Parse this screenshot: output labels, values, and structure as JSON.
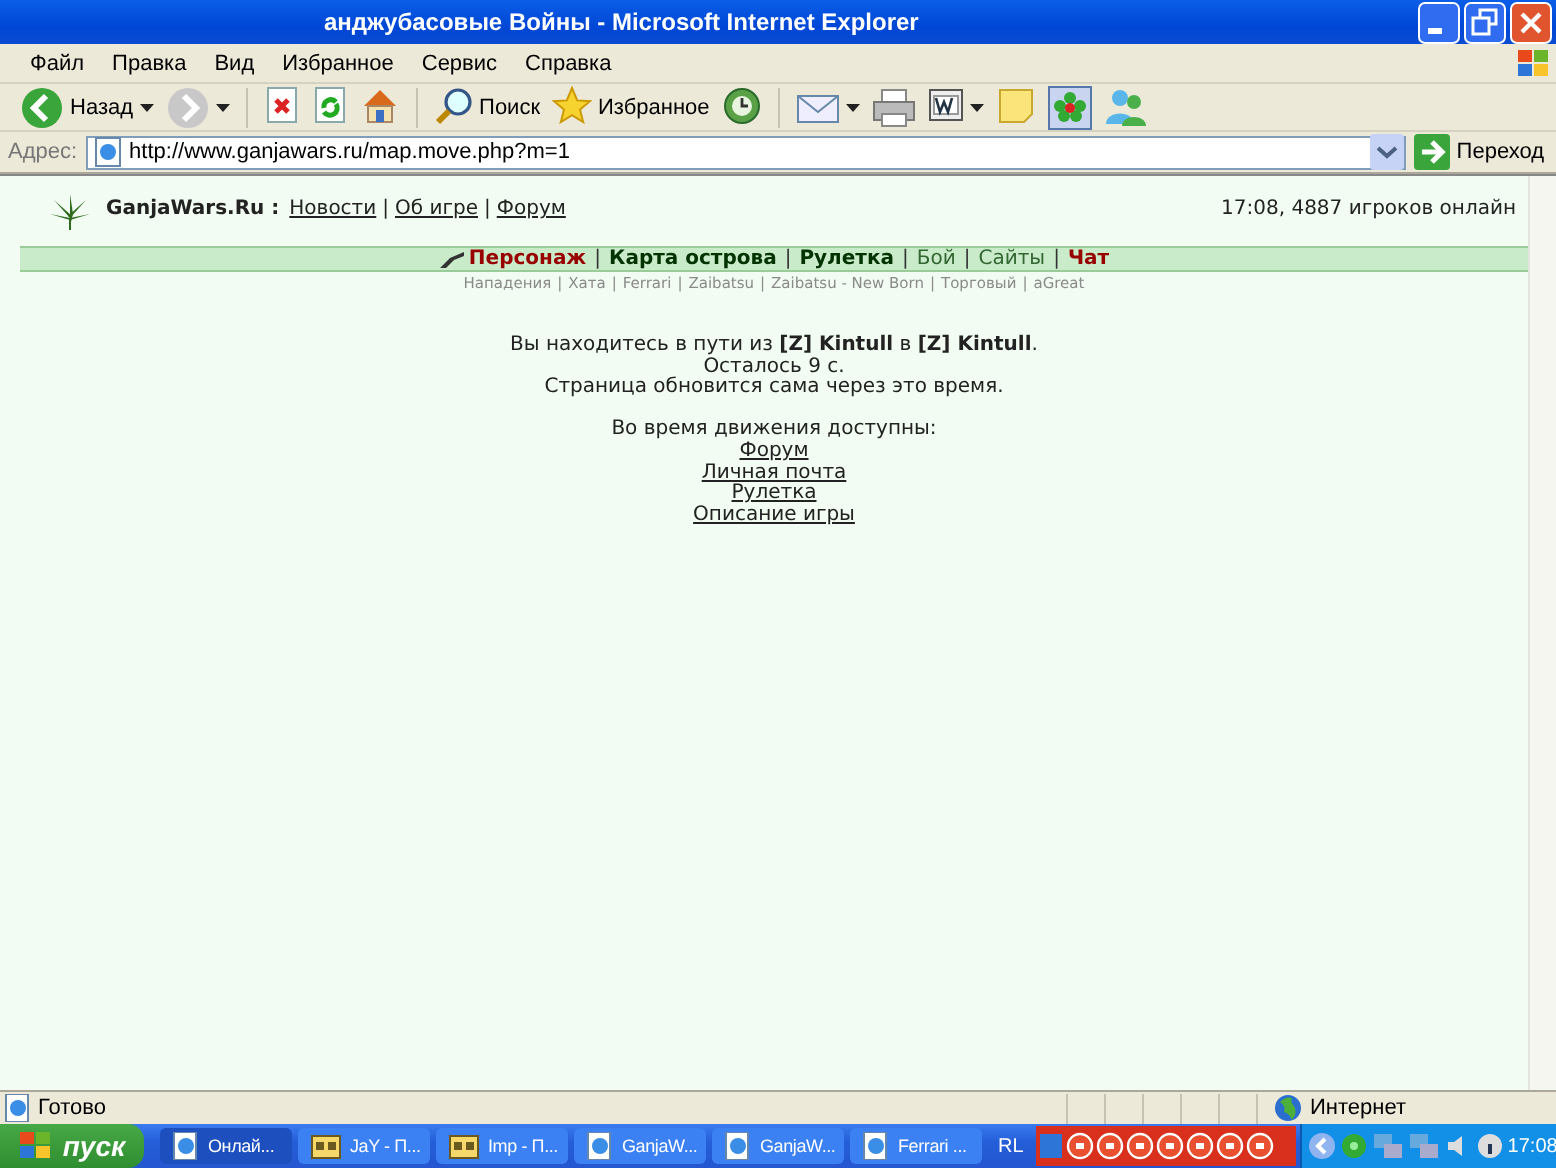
{
  "window": {
    "title": "анджубасовые Войны - Microsoft Internet Explorer"
  },
  "menu": [
    {
      "label": "Файл"
    },
    {
      "label": "Правка"
    },
    {
      "label": "Вид"
    },
    {
      "label": "Избранное"
    },
    {
      "label": "Сервис"
    },
    {
      "label": "Справка"
    }
  ],
  "toolbar": [
    {
      "kind": "back",
      "label": "Назад"
    },
    {
      "kind": "drop"
    },
    {
      "kind": "forward"
    },
    {
      "kind": "drop"
    },
    {
      "kind": "sep"
    },
    {
      "kind": "stop"
    },
    {
      "kind": "refresh"
    },
    {
      "kind": "home"
    },
    {
      "kind": "sep"
    },
    {
      "kind": "search",
      "label": "Поиск"
    },
    {
      "kind": "favorites",
      "label": "Избранное"
    },
    {
      "kind": "history"
    },
    {
      "kind": "sep"
    },
    {
      "kind": "mail"
    },
    {
      "kind": "drop"
    },
    {
      "kind": "print"
    },
    {
      "kind": "word"
    },
    {
      "kind": "drop"
    },
    {
      "kind": "note"
    },
    {
      "kind": "flower"
    },
    {
      "kind": "messenger"
    }
  ],
  "address": {
    "label": "Адрес:",
    "value": "http://www.ganjawars.ru/map.move.php?m=1",
    "go": "Переход"
  },
  "page": {
    "site": "GanjaWars.Ru :",
    "links": [
      {
        "kind": "link",
        "text": "Новости"
      },
      {
        "kind": "sep",
        "text": "|"
      },
      {
        "kind": "link",
        "text": "Об игре"
      },
      {
        "kind": "sep",
        "text": "|"
      },
      {
        "kind": "link",
        "text": "Форум"
      }
    ],
    "online": "17:08, 4887 игроков онлайн",
    "nav": [
      {
        "kind": "gunlink",
        "text": "Персонаж",
        "color": "#990000"
      },
      {
        "kind": "sep",
        "text": "|"
      },
      {
        "kind": "bold",
        "text": "Карта острова",
        "color": "#003300"
      },
      {
        "kind": "sep",
        "text": "|"
      },
      {
        "kind": "bold",
        "text": "Рулетка",
        "color": "#003300"
      },
      {
        "kind": "sep",
        "text": "|"
      },
      {
        "kind": "plain",
        "text": "Бой",
        "color": "#336633"
      },
      {
        "kind": "sep",
        "text": "|"
      },
      {
        "kind": "plain",
        "text": "Сайты",
        "color": "#336633"
      },
      {
        "kind": "sep",
        "text": "|"
      },
      {
        "kind": "bold",
        "text": "Чат",
        "color": "#990000"
      }
    ],
    "subnav": [
      "Нападения",
      "|",
      "Хата",
      "|",
      "Ferrari",
      "|",
      "Zaibatsu",
      "|",
      "Zaibatsu - New Born",
      "|",
      "Торговый",
      "|",
      "aGreat"
    ],
    "message": [
      "Вы находитесь в пути из **[Z] Kintull** в **[Z] Kintull**.",
      "Осталось 9 с.",
      "Страница обновится сама через это время."
    ],
    "available": "Во время движения доступны:",
    "actions": [
      "Форум",
      "Личная почта",
      "Рулетка",
      "Описание игры"
    ]
  },
  "status_bar": {
    "text": "Готово",
    "zone": "Интернет"
  },
  "taskbar": {
    "start": "пуск",
    "buttons": [
      {
        "kind": "ie",
        "label": "Онлай...",
        "selected": true
      },
      {
        "kind": "chat",
        "label": "JaY - П...",
        "selected": false
      },
      {
        "kind": "chat",
        "label": "Imp - П...",
        "selected": false
      },
      {
        "kind": "ie",
        "label": "GanjaW...",
        "selected": false
      },
      {
        "kind": "ie",
        "label": "GanjaW...",
        "selected": false
      },
      {
        "kind": "ie",
        "label": "Ferrari ...",
        "selected": false
      }
    ],
    "toolbar_label": "RL",
    "clock": "17:08"
  }
}
